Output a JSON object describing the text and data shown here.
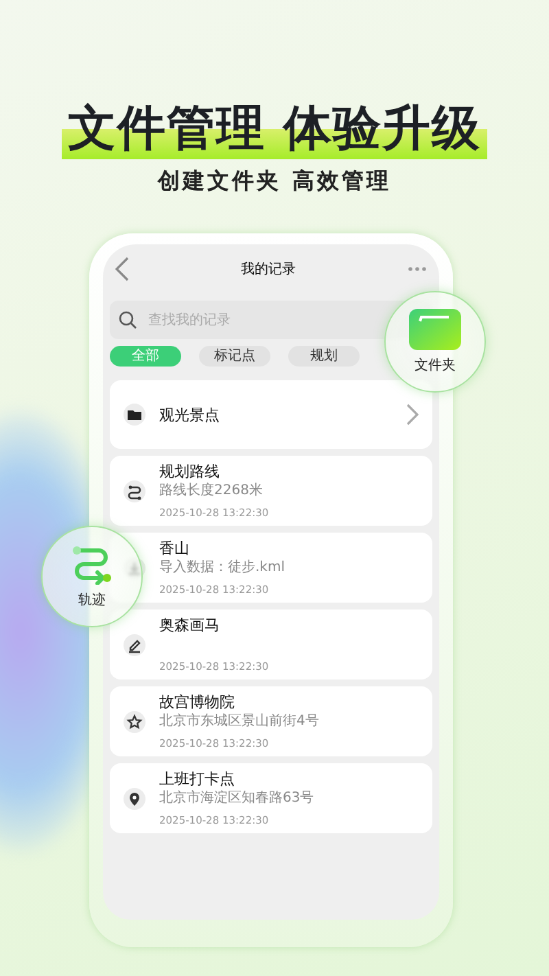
{
  "headline": "文件管理 体验升级",
  "subtitle": "创建文件夹 高效管理",
  "screen": {
    "title": "我的记录",
    "search": {
      "placeholder": "查找我的记录"
    },
    "chips": [
      {
        "label": "全部",
        "selected": true
      },
      {
        "label": "标记点",
        "selected": false
      },
      {
        "label": "规划",
        "selected": false
      }
    ],
    "folder": {
      "name": "观光景点"
    },
    "records": [
      {
        "kind": "route",
        "title": "规划路线",
        "detail": "路线长度2268米",
        "time": "2025-10-28  13:22:30"
      },
      {
        "kind": "import",
        "title": "香山",
        "detail": "导入数据：徒步.kml",
        "time": "2025-10-28  13:22:30"
      },
      {
        "kind": "drawing",
        "title": "奥森画马",
        "time": "2025-10-28  13:22:30"
      },
      {
        "kind": "star",
        "title": "故宫博物院",
        "detail": "北京市东城区景山前街4号",
        "time": "2025-10-28  13:22:30"
      },
      {
        "kind": "pin",
        "title": "上班打卡点",
        "detail": "北京市海淀区知春路63号",
        "time": "2025-10-28  13:22:30"
      }
    ]
  },
  "bubbles": [
    {
      "kind": "folder",
      "label": "文件夹"
    },
    {
      "kind": "track",
      "label": "轨迹"
    }
  ]
}
